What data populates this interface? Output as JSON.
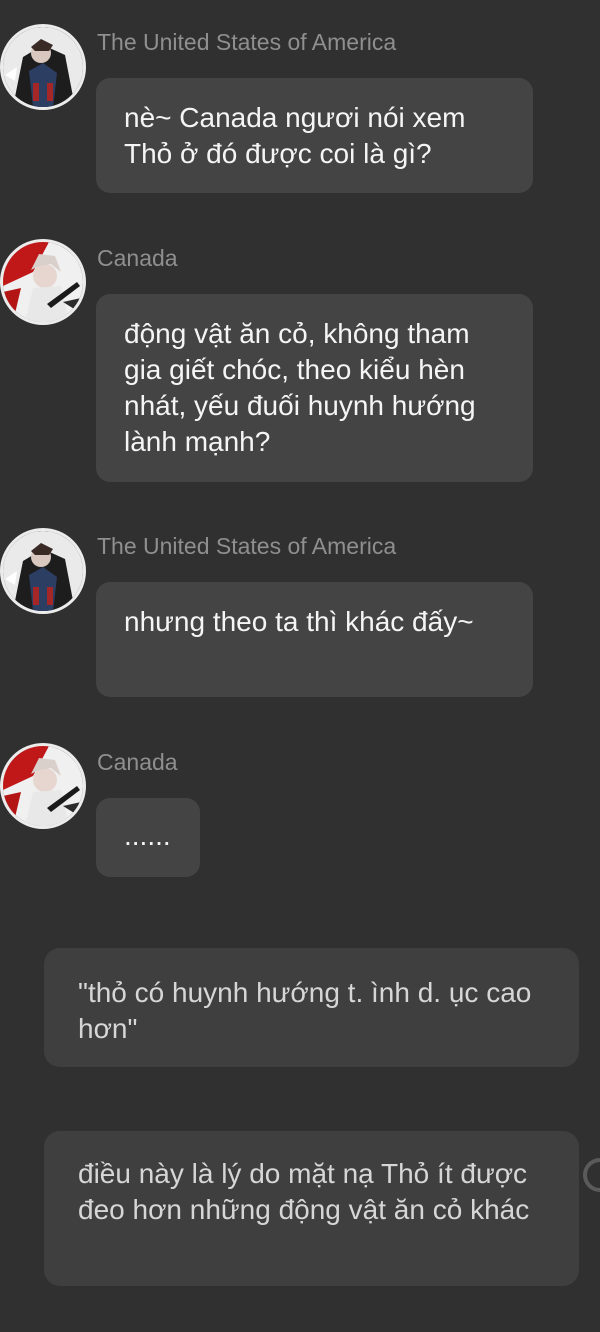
{
  "messages": [
    {
      "sender": "The United States of America",
      "avatar_icon": "usa-character-avatar",
      "text": "nè~ Canada ngươi nói xem Thỏ ở đó được coi là gì?"
    },
    {
      "sender": "Canada",
      "avatar_icon": "canada-character-avatar",
      "text": "động vật ăn cỏ, không tham gia giết chóc, theo kiểu hèn nhát, yếu đuối huynh hướng lành mạnh?"
    },
    {
      "sender": "The United States of America",
      "avatar_icon": "usa-character-avatar",
      "text": "nhưng theo ta thì khác đấy~"
    },
    {
      "sender": "Canada",
      "avatar_icon": "canada-character-avatar",
      "text": "......"
    }
  ],
  "narrations": [
    {
      "text": "\"thỏ có huynh hướng t. ình d. ục cao hơn\""
    },
    {
      "text": "điều này là lý do mặt nạ Thỏ ít được đeo hơn những động vật ăn cỏ khác"
    }
  ],
  "colors": {
    "background": "#303030",
    "bubble": "#444444",
    "narration_bubble": "#3f3f3f",
    "sender_name": "#8f8f8f",
    "text": "#f5f5f5"
  }
}
